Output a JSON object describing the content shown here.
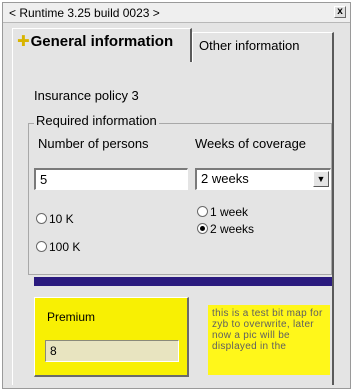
{
  "window": {
    "title": "< Runtime 3.25 build 0023 >",
    "close_glyph": "x"
  },
  "tabs": [
    {
      "label": "General information",
      "active": true,
      "icon": "plus-icon"
    },
    {
      "label": "Other information",
      "active": false
    }
  ],
  "general": {
    "policy_label": "Insurance policy 3",
    "required_group": {
      "legend": "Required information",
      "persons": {
        "label": "Number of persons",
        "value": "5",
        "options": [
          "10 K",
          "100 K"
        ],
        "selected": null
      },
      "weeks": {
        "label": "Weeks of coverage",
        "selected": "2 weeks",
        "options": [
          "1 week",
          "2 weeks"
        ],
        "checked": "2 weeks"
      }
    },
    "premium": {
      "label": "Premium",
      "value": "8"
    },
    "bitmap_note": "this is a test bit map for zyb to overwrite, later now a pic will be displayed in the"
  },
  "colors": {
    "divider": "#2a1a7e",
    "premium_bg": "#f8f003",
    "bitmap_bg": "#fff71a",
    "tab_icon": "#d8b400"
  }
}
